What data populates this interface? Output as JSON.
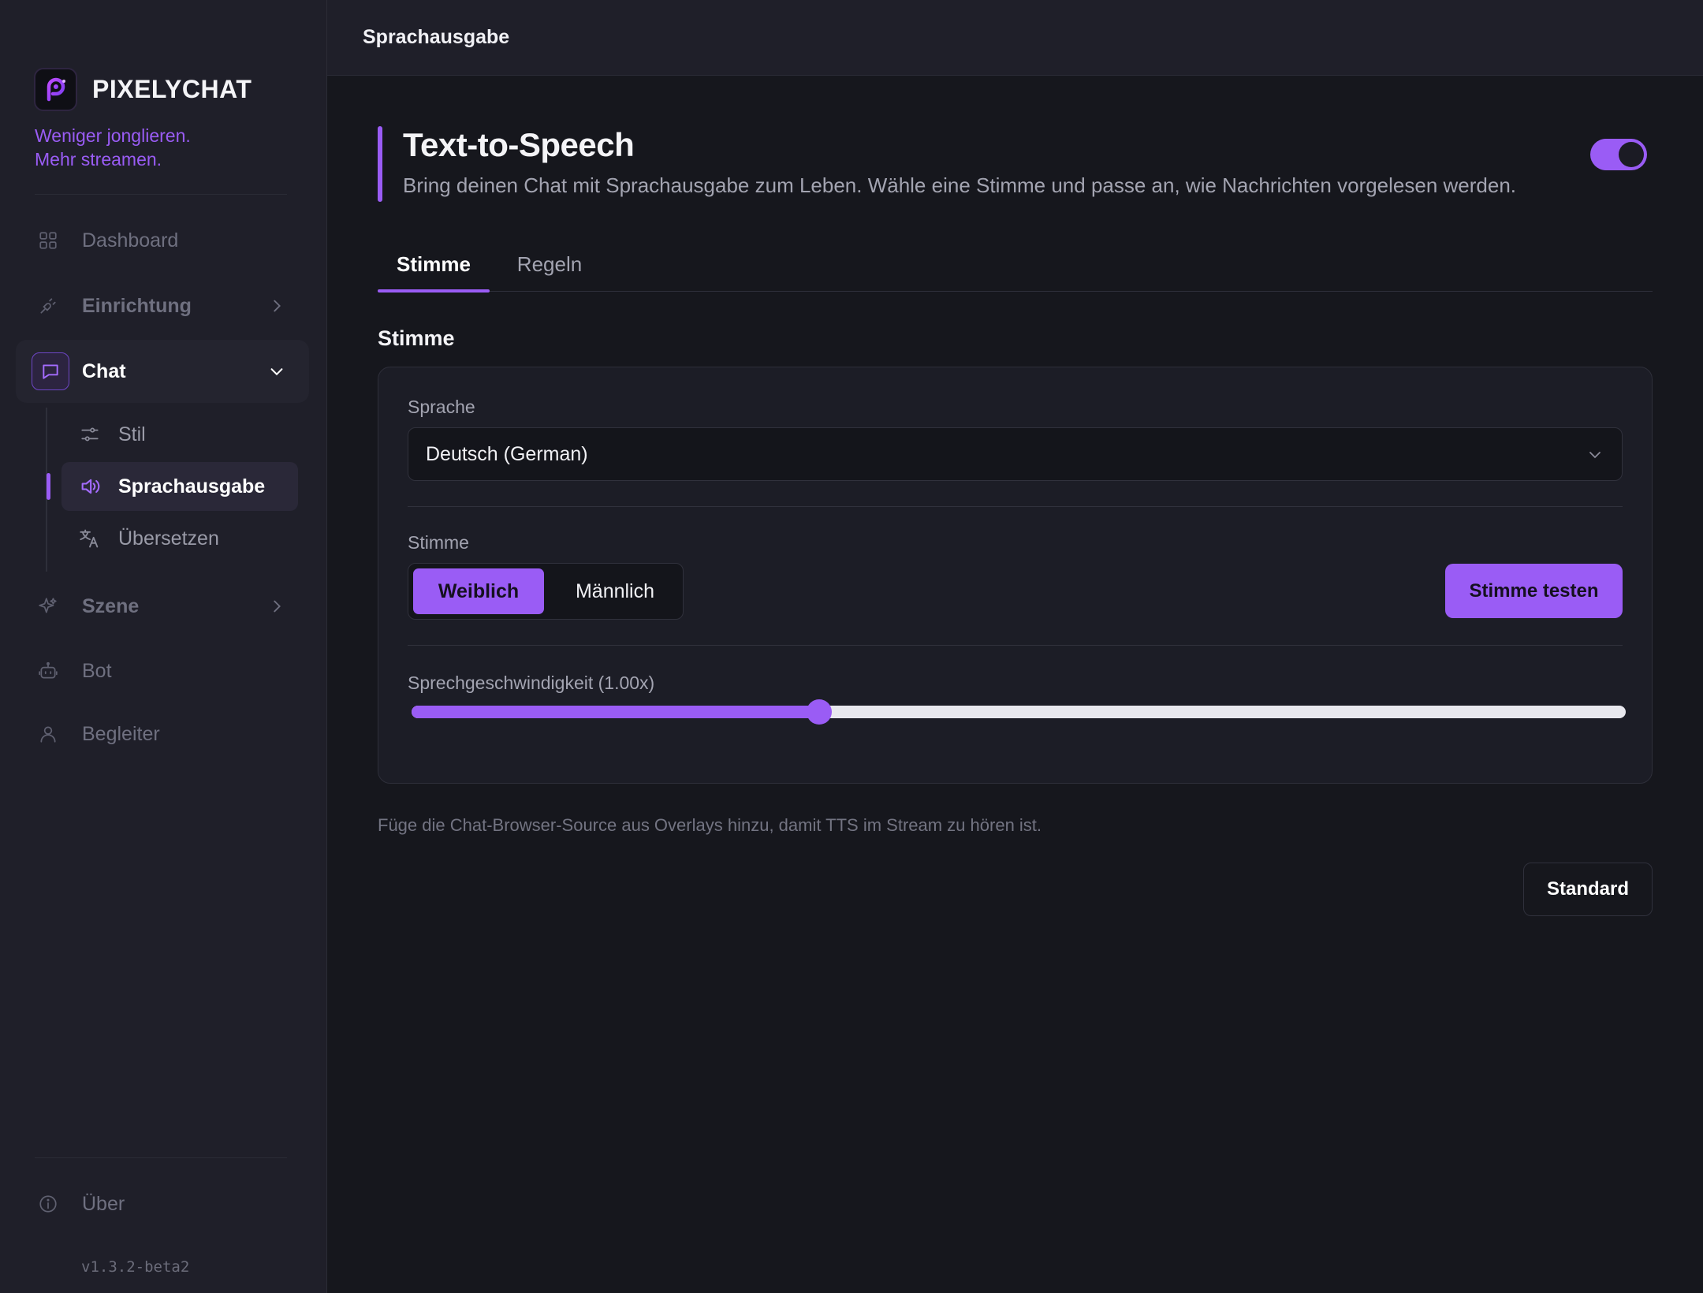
{
  "app": {
    "name": "PIXELYCHAT",
    "tagline_line1": "Weniger jonglieren.",
    "tagline_line2": "Mehr streamen.",
    "version": "v1.3.2-beta2",
    "accent_color": "#9a5cf5"
  },
  "sidebar": {
    "items": [
      {
        "label": "Dashboard",
        "icon": "grid-icon"
      },
      {
        "label": "Einrichtung",
        "icon": "plug-icon"
      },
      {
        "label": "Chat",
        "icon": "chat-bubble-icon"
      },
      {
        "label": "Szene",
        "icon": "sparkle-icon"
      },
      {
        "label": "Bot",
        "icon": "robot-icon"
      },
      {
        "label": "Begleiter",
        "icon": "user-icon"
      },
      {
        "label": "Über",
        "icon": "info-icon"
      }
    ],
    "chat_sub": [
      {
        "label": "Stil",
        "icon": "sliders-icon"
      },
      {
        "label": "Sprachausgabe",
        "icon": "speaker-icon"
      },
      {
        "label": "Übersetzen",
        "icon": "translate-icon"
      }
    ]
  },
  "header": {
    "title": "Sprachausgabe"
  },
  "hero": {
    "title": "Text-to-Speech",
    "subtitle": "Bring deinen Chat mit Sprachausgabe zum Leben. Wähle eine Stimme und passe an, wie Nachrichten vorgelesen werden.",
    "enabled": true
  },
  "tabs": [
    {
      "label": "Stimme",
      "active": true
    },
    {
      "label": "Regeln",
      "active": false
    }
  ],
  "section": {
    "title": "Stimme",
    "language_label": "Sprache",
    "language_value": "Deutsch (German)",
    "voice_label": "Stimme",
    "voice_options": [
      "Weiblich",
      "Männlich"
    ],
    "voice_selected": "Weiblich",
    "test_button": "Stimme testen",
    "speed_label": "Sprechgeschwindigkeit (1.00x)",
    "speed_fraction": 0.336
  },
  "hint": "Füge die Chat-Browser-Source aus Overlays hinzu, damit TTS im Stream zu hören ist.",
  "footer": {
    "reset_button": "Standard"
  }
}
